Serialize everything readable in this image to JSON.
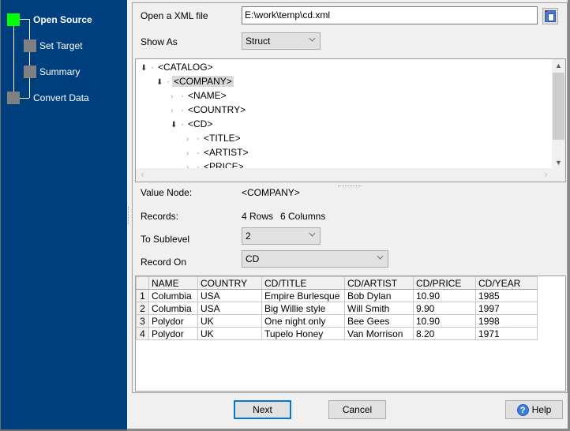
{
  "wizard": {
    "steps": [
      {
        "label": "Open Source",
        "status": "active"
      },
      {
        "label": "Set Target",
        "status": "pending"
      },
      {
        "label": "Summary",
        "status": "pending"
      },
      {
        "label": "Convert Data",
        "status": "pending"
      }
    ],
    "colors": {
      "active": "#00ff00",
      "pending": "#808080",
      "panel": "#003f7d"
    }
  },
  "source": {
    "open_label": "Open a XML file",
    "file_path": "E:\\work\\temp\\cd.xml",
    "show_as_label": "Show As",
    "show_as_value": "Struct"
  },
  "tree": {
    "nodes": [
      {
        "tag": "<CATALOG>",
        "level": 0,
        "expanded": true
      },
      {
        "tag": "<COMPANY>",
        "level": 1,
        "expanded": true,
        "selected": true
      },
      {
        "tag": "<NAME>",
        "level": 2,
        "expanded": false
      },
      {
        "tag": "<COUNTRY>",
        "level": 2,
        "expanded": false
      },
      {
        "tag": "<CD>",
        "level": 2,
        "expanded": true
      },
      {
        "tag": "<TITLE>",
        "level": 3,
        "expanded": false
      },
      {
        "tag": "<ARTIST>",
        "level": 3,
        "expanded": false
      },
      {
        "tag": "<PRICE>",
        "level": 3,
        "expanded": false
      }
    ]
  },
  "info": {
    "value_node_label": "Value Node:",
    "value_node": "<COMPANY>",
    "records_label": "Records:",
    "rows": "4 Rows",
    "columns": "6 Columns",
    "sublevel_label": "To Sublevel",
    "sublevel_value": "2",
    "record_on_label": "Record On",
    "record_on_value": "CD"
  },
  "grid": {
    "columns": [
      "NAME",
      "COUNTRY",
      "CD/TITLE",
      "CD/ARTIST",
      "CD/PRICE",
      "CD/YEAR"
    ],
    "rows": [
      {
        "num": "1",
        "cells": [
          "Columbia",
          "USA",
          "Empire Burlesque",
          "Bob Dylan",
          "10.90",
          "1985"
        ]
      },
      {
        "num": "2",
        "cells": [
          "Columbia",
          "USA",
          "Big Willie style",
          "Will Smith",
          "9.90",
          "1997"
        ]
      },
      {
        "num": "3",
        "cells": [
          "Polydor",
          "UK",
          "One night only",
          "Bee Gees",
          "10.90",
          "1998"
        ]
      },
      {
        "num": "4",
        "cells": [
          "Polydor",
          "UK",
          "Tupelo Honey",
          "Van Morrison",
          "8.20",
          "1971"
        ]
      }
    ]
  },
  "buttons": {
    "next": "Next",
    "cancel": "Cancel",
    "help": "Help"
  }
}
